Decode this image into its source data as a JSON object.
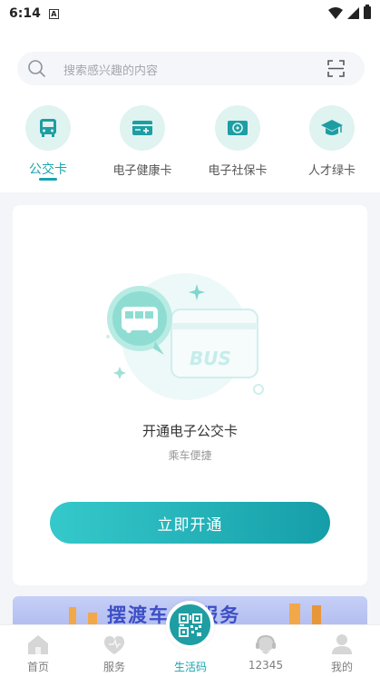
{
  "status_bar": {
    "time": "6:14",
    "app_icon_letter": "A"
  },
  "search": {
    "placeholder": "搜索感兴趣的内容"
  },
  "card_tabs": [
    {
      "label": "公交卡",
      "icon": "bus-icon",
      "active": true
    },
    {
      "label": "电子健康卡",
      "icon": "health-card-icon",
      "active": false
    },
    {
      "label": "电子社保卡",
      "icon": "social-security-card-icon",
      "active": false
    },
    {
      "label": "人才绿卡",
      "icon": "graduation-cap-icon",
      "active": false
    }
  ],
  "main_card": {
    "illustration_text": "BUS",
    "title": "开通电子公交卡",
    "subtitle": "乘车便捷",
    "button_label": "立即开通"
  },
  "banner": {
    "text": "摆渡车  的服务"
  },
  "bottom_nav": [
    {
      "label": "首页",
      "icon": "home-icon"
    },
    {
      "label": "服务",
      "icon": "service-icon"
    },
    {
      "label": "生活码",
      "icon": "qr-code-icon",
      "active": true
    },
    {
      "label": "12345",
      "icon": "hotline-icon"
    },
    {
      "label": "我的",
      "icon": "profile-icon"
    }
  ],
  "colors": {
    "accent": "#18a4ae",
    "button_start": "#35c9cb",
    "button_end": "#169ea8",
    "background_grey": "#f3f5f8",
    "icon_bg": "#dff3f1",
    "banner_text": "#3d4ec6"
  }
}
